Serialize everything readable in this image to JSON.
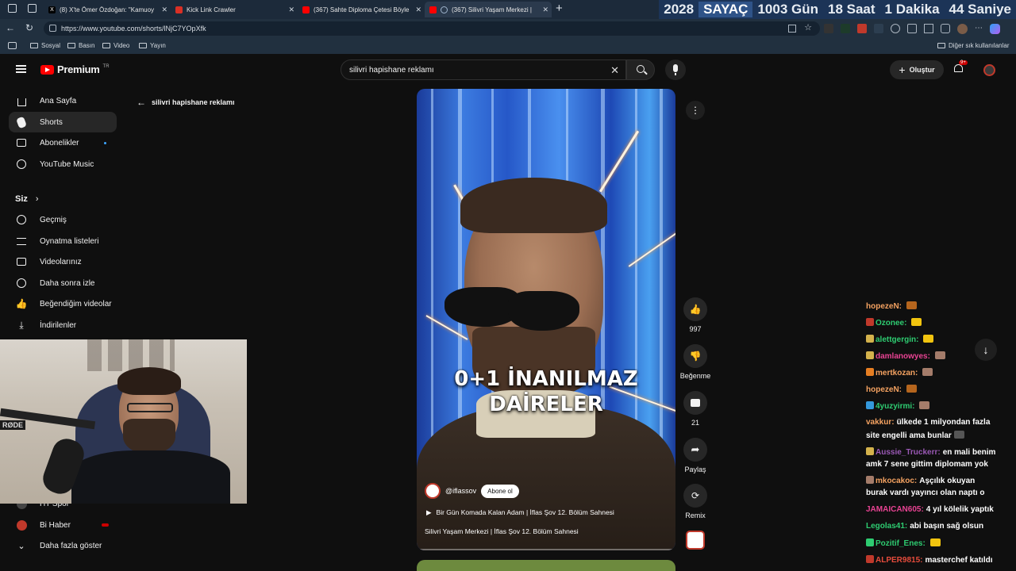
{
  "browser": {
    "tabs": [
      {
        "title": "(8) X'te Ömer Özdoğan: \"Kamuoy",
        "favicon_color": "#000000"
      },
      {
        "title": "Kick Link Crawler",
        "favicon_color": "#d93025"
      },
      {
        "title": "(367) Sahte Diploma Çetesi Böyle",
        "favicon_color": "#ff0000"
      },
      {
        "title": "(367) Silivri Yaşam Merkezi |",
        "favicon_color": "#ff0000"
      }
    ],
    "new_tab_label": "+",
    "url": "https://www.youtube.com/shorts/lNjC7YOpXfk",
    "bookmarks": [
      "Sosyal",
      "Basın",
      "Video",
      "Yayın"
    ],
    "other_bookmarks": "Diğer sık kullanılanlar"
  },
  "timer": {
    "year": "2028",
    "label": "SAYAÇ",
    "days": "1003 Gün",
    "hours": "18 Saat",
    "minutes": "1 Dakika",
    "seconds": "44 Saniye"
  },
  "youtube": {
    "logo_text": "Premium",
    "logo_region": "TR",
    "search_value": "silivri hapishane reklamı",
    "create_label": "Oluştur",
    "notif_count": "9+",
    "back_query": "silivri hapishane reklamı",
    "sidebar": {
      "main": [
        "Ana Sayfa",
        "Shorts",
        "Abonelikler",
        "YouTube Music"
      ],
      "siz_heading": "Siz",
      "siz_items": [
        "Geçmiş",
        "Oynatma listeleri",
        "Videolarınız",
        "Daha sonra izle",
        "Beğendiğim videolar",
        "İndirilenler"
      ],
      "subs": [
        "HT Spor",
        "Bi Haber"
      ],
      "show_more": "Daha fazla göster"
    },
    "short": {
      "overlay_line1": "0+1 İNANILMAZ",
      "overlay_line2": "DAİRELER",
      "channel": "@iflassov",
      "subscribe": "Abone ol",
      "playlist_title": "Bir Gün Komada Kalan Adam | İflas Şov 12. Bölüm Sahnesi",
      "title": "Silivri Yaşam Merkezi | İflas Şov 12. Bölüm Sahnesi",
      "likes": "997",
      "dislike_label": "Beğenme",
      "comments": "21",
      "share_label": "Paylaş",
      "remix_label": "Remix"
    }
  },
  "chat": [
    {
      "user": "hopezeN:",
      "msg": "",
      "color": "#f4a261",
      "badge": "",
      "emote": "#b5651d"
    },
    {
      "user": "Ozonee:",
      "msg": "",
      "color": "#2ecc71",
      "badge": "#c0392b",
      "emote": "#f1c40f"
    },
    {
      "user": "alettgergin:",
      "msg": "",
      "color": "#2ecc71",
      "badge": "#d4b24c",
      "emote": "#f1c40f"
    },
    {
      "user": "damlanowyes:",
      "msg": "",
      "color": "#e84393",
      "badge": "#d4b24c",
      "emote": "#a47c6a"
    },
    {
      "user": "mertkozan:",
      "msg": "",
      "color": "#f4a261",
      "badge": "#e67e22",
      "emote": "#a47c6a"
    },
    {
      "user": "hopezeN:",
      "msg": "",
      "color": "#f4a261",
      "badge": "",
      "emote": "#b5651d"
    },
    {
      "user": "4yuzyirmi:",
      "msg": "",
      "color": "#2ecc71",
      "badge": "#3498db",
      "emote": "#a47c6a"
    },
    {
      "user": "vakkur:",
      "msg": "ülkede 1 milyondan fazla",
      "color": "#f4a261",
      "badge": "",
      "emote": ""
    },
    {
      "user": "",
      "msg": "site engelli ama bunlar",
      "color": "#ffffff",
      "badge": "",
      "emote": "#555555"
    },
    {
      "user": "Aussie_Truckerr:",
      "msg": "en mali benim",
      "color": "#9b59b6",
      "badge": "#d4b24c",
      "emote": ""
    },
    {
      "user": "",
      "msg": "amk 7 sene gittim diplomam yok",
      "color": "#ffffff",
      "badge": "",
      "emote": ""
    },
    {
      "user": "mkocakoc:",
      "msg": "Aşçılık okuyan",
      "color": "#f4a261",
      "badge": "#a47c6a",
      "emote": ""
    },
    {
      "user": "",
      "msg": "burak vardı yayıncı olan naptı o",
      "color": "#ffffff",
      "badge": "",
      "emote": ""
    },
    {
      "user": "JAMAICAN605:",
      "msg": "4 yıl kölelik yaptık",
      "color": "#e84393",
      "badge": "",
      "emote": ""
    },
    {
      "user": "Legolas41:",
      "msg": "abi başın sağ olsun",
      "color": "#2ecc71",
      "badge": "",
      "emote": ""
    },
    {
      "user": "Pozitif_Enes:",
      "msg": "",
      "color": "#2ecc71",
      "badge": "#2ecc71",
      "emote": "#f1c40f"
    },
    {
      "user": "ALPER9815:",
      "msg": "masterchef katıldı",
      "color": "#e74c3c",
      "badge": "#c0392b",
      "emote": ""
    }
  ]
}
